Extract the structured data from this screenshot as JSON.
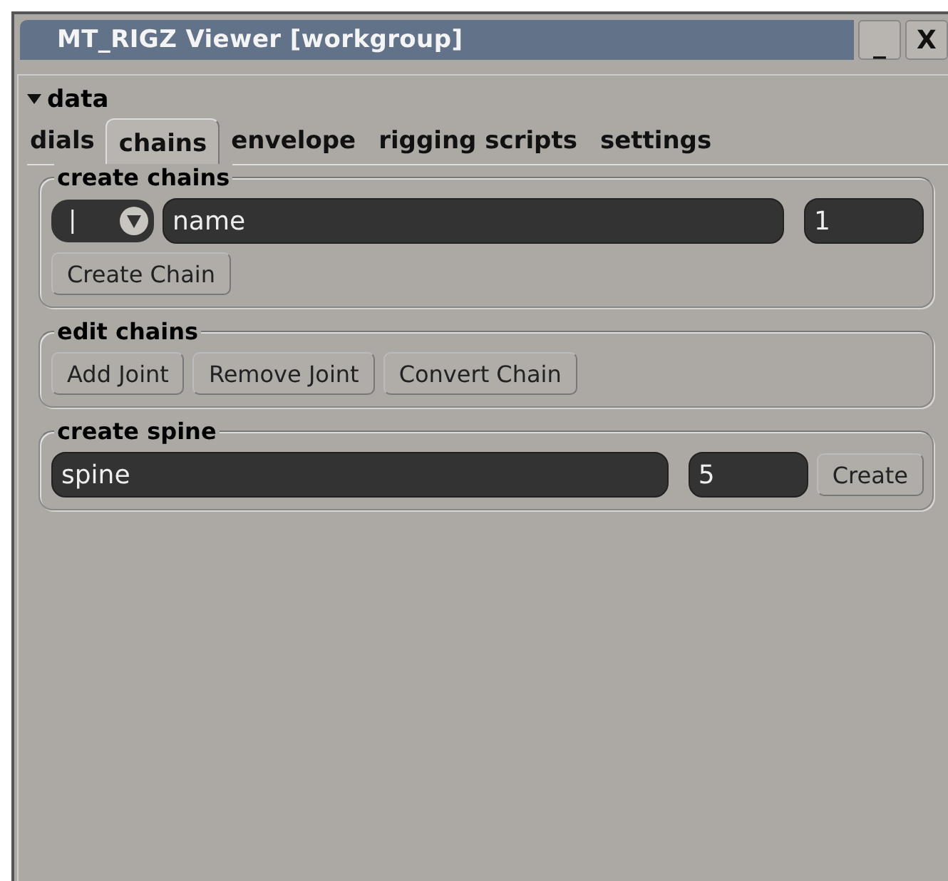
{
  "window": {
    "title": "MT_RIGZ Viewer [workgroup]",
    "controls": [
      "_",
      "X"
    ]
  },
  "section": {
    "label": "data",
    "expanded": true
  },
  "tabs": [
    {
      "label": "dials",
      "selected": false
    },
    {
      "label": "chains",
      "selected": true
    },
    {
      "label": "envelope",
      "selected": false
    },
    {
      "label": "rigging scripts",
      "selected": false
    },
    {
      "label": "settings",
      "selected": false
    }
  ],
  "groups": [
    {
      "title": "create chains",
      "rows": [
        [
          {
            "kind": "dropdown",
            "value": "|"
          },
          {
            "kind": "field",
            "value": "name"
          },
          {
            "kind": "field",
            "value": "1"
          }
        ],
        [
          {
            "kind": "button",
            "label": "Create Chain"
          }
        ]
      ]
    },
    {
      "title": "edit chains",
      "rows": [
        [
          {
            "kind": "button",
            "label": "Add Joint"
          },
          {
            "kind": "button",
            "label": "Remove Joint"
          },
          {
            "kind": "button",
            "label": "Convert Chain"
          }
        ]
      ]
    },
    {
      "title": "create spine",
      "rows": [
        [
          {
            "kind": "field",
            "value": "spine"
          },
          {
            "kind": "field",
            "value": "5"
          },
          {
            "kind": "button",
            "label": "Create"
          }
        ]
      ]
    }
  ]
}
